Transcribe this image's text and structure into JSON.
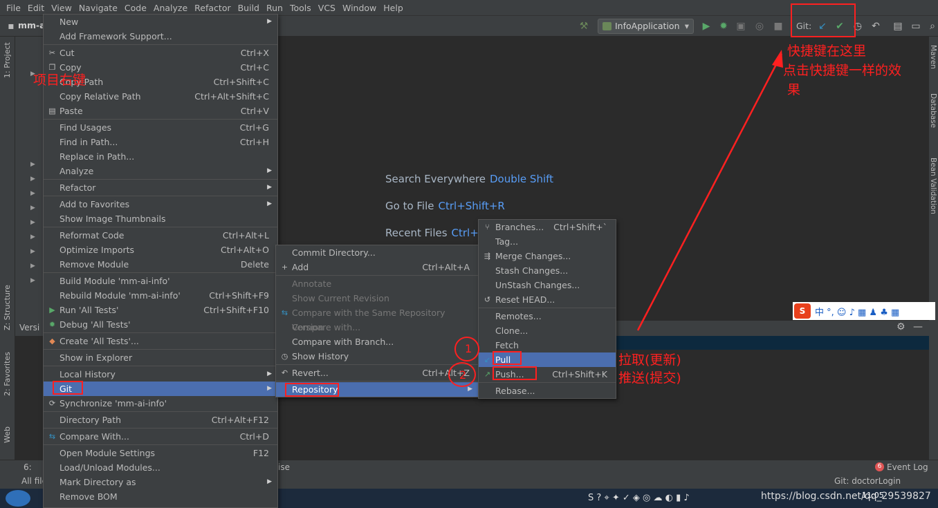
{
  "menubar": [
    "File",
    "Edit",
    "View",
    "Navigate",
    "Code",
    "Analyze",
    "Refactor",
    "Build",
    "Run",
    "Tools",
    "VCS",
    "Window",
    "Help"
  ],
  "toolbar": {
    "project": "mm-a",
    "run_config": "InfoApplication",
    "git_label": "Git:"
  },
  "left_strip": {
    "project": "1: Project",
    "structure": "Z: Structure",
    "favorites": "2: Favorites",
    "web": "Web"
  },
  "right_strip": {
    "maven": "Maven",
    "database": "Database",
    "bean": "Bean Validation"
  },
  "editor_hints": [
    {
      "text": "Search Everywhere",
      "key": "Double Shift"
    },
    {
      "text": "Go to File",
      "key": "Ctrl+Shift+R"
    },
    {
      "text": "Recent Files",
      "key": "Ctrl+"
    }
  ],
  "context_menu": [
    {
      "label": "New",
      "sub": true
    },
    {
      "label": "Add Framework Support..."
    },
    {
      "sep": true
    },
    {
      "label": "Cut",
      "shortcut": "Ctrl+X",
      "icon": "cut-icon"
    },
    {
      "label": "Copy",
      "shortcut": "Ctrl+C",
      "icon": "copy-icon"
    },
    {
      "label": "Copy Path",
      "shortcut": "Ctrl+Shift+C"
    },
    {
      "label": "Copy Relative Path",
      "shortcut": "Ctrl+Alt+Shift+C"
    },
    {
      "label": "Paste",
      "shortcut": "Ctrl+V",
      "icon": "paste-icon"
    },
    {
      "sep": true
    },
    {
      "label": "Find Usages",
      "shortcut": "Ctrl+G"
    },
    {
      "label": "Find in Path...",
      "shortcut": "Ctrl+H"
    },
    {
      "label": "Replace in Path..."
    },
    {
      "label": "Analyze",
      "sub": true
    },
    {
      "sep": true
    },
    {
      "label": "Refactor",
      "sub": true
    },
    {
      "sep": true
    },
    {
      "label": "Add to Favorites",
      "sub": true
    },
    {
      "label": "Show Image Thumbnails"
    },
    {
      "sep": true
    },
    {
      "label": "Reformat Code",
      "shortcut": "Ctrl+Alt+L"
    },
    {
      "label": "Optimize Imports",
      "shortcut": "Ctrl+Alt+O"
    },
    {
      "label": "Remove Module",
      "shortcut": "Delete"
    },
    {
      "sep": true
    },
    {
      "label": "Build Module 'mm-ai-info'"
    },
    {
      "label": "Rebuild Module 'mm-ai-info'",
      "shortcut": "Ctrl+Shift+F9"
    },
    {
      "label": "Run 'All Tests'",
      "shortcut": "Ctrl+Shift+F10",
      "icon": "run-icon"
    },
    {
      "label": "Debug 'All Tests'",
      "icon": "debug-icon"
    },
    {
      "sep": true
    },
    {
      "label": "Create 'All Tests'...",
      "icon": "create-test-icon"
    },
    {
      "sep": true
    },
    {
      "label": "Show in Explorer"
    },
    {
      "sep": true
    },
    {
      "label": "Local History",
      "sub": true
    },
    {
      "label": "Git",
      "sub": true,
      "selected": true
    },
    {
      "label": "Synchronize 'mm-ai-info'",
      "icon": "sync-icon"
    },
    {
      "sep": true
    },
    {
      "label": "Directory Path",
      "shortcut": "Ctrl+Alt+F12"
    },
    {
      "sep": true
    },
    {
      "label": "Compare With...",
      "shortcut": "Ctrl+D",
      "icon": "compare-icon"
    },
    {
      "sep": true
    },
    {
      "label": "Open Module Settings",
      "shortcut": "F12"
    },
    {
      "label": "Load/Unload Modules..."
    },
    {
      "label": "Mark Directory as",
      "sub": true
    },
    {
      "label": "Remove BOM"
    }
  ],
  "git_menu": [
    {
      "label": "Commit Directory..."
    },
    {
      "label": "Add",
      "shortcut": "Ctrl+Alt+A",
      "icon": "plus-icon"
    },
    {
      "sep": true
    },
    {
      "label": "Annotate",
      "disabled": true
    },
    {
      "label": "Show Current Revision",
      "disabled": true
    },
    {
      "label": "Compare with the Same Repository Version",
      "disabled": true,
      "icon": "compare-icon"
    },
    {
      "label": "Compare with...",
      "disabled": true
    },
    {
      "label": "Compare with Branch..."
    },
    {
      "label": "Show History",
      "icon": "history-icon"
    },
    {
      "sep": true
    },
    {
      "label": "Revert...",
      "shortcut": "Ctrl+Alt+Z",
      "icon": "revert-icon"
    },
    {
      "sep": true
    },
    {
      "label": "Repository",
      "sub": true,
      "selected": true
    }
  ],
  "repo_menu": [
    {
      "label": "Branches...",
      "shortcut": "Ctrl+Shift+`",
      "icon": "branch-icon"
    },
    {
      "label": "Tag..."
    },
    {
      "label": "Merge Changes...",
      "icon": "merge-icon"
    },
    {
      "label": "Stash Changes..."
    },
    {
      "label": "UnStash Changes..."
    },
    {
      "label": "Reset HEAD...",
      "icon": "reset-icon"
    },
    {
      "sep": true
    },
    {
      "label": "Remotes..."
    },
    {
      "label": "Clone..."
    },
    {
      "label": "Fetch"
    },
    {
      "label": "Pull",
      "selected": true,
      "icon": "pull-icon"
    },
    {
      "label": "Push...",
      "shortcut": "Ctrl+Shift+K",
      "icon": "push-icon"
    },
    {
      "sep": true
    },
    {
      "label": "Rebase..."
    }
  ],
  "annotations": {
    "project_right_click": "项目右键",
    "shortcut_here": "快捷键在这里",
    "shortcut_effect_1": "点击快捷键一样的效",
    "shortcut_effect_2": "果",
    "pull_note": "拉取(更新)",
    "push_note": "推送(提交)",
    "circle_1": "1",
    "circle_2": "2"
  },
  "status": {
    "event_log": "Event Log",
    "event_count": "6",
    "branch": "Git: doctorLogin",
    "left_tab": "6:",
    "left_files": "All file",
    "mid": "ise",
    "version": "Versi",
    "time": "11:05",
    "watermark": "https://blog.csdn.net/qq_29539827"
  },
  "colors": {
    "accent": "#4b6eaf",
    "annotation": "#ff2020",
    "hint_key": "#589df6"
  }
}
